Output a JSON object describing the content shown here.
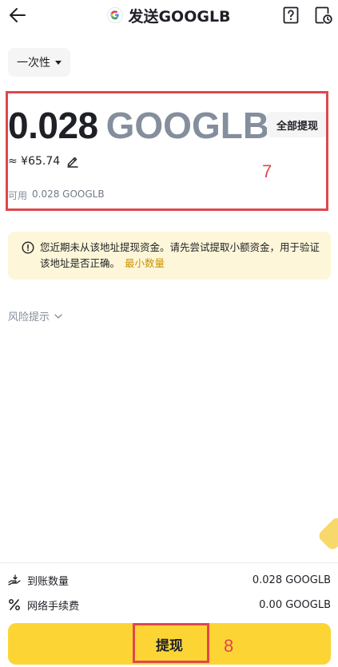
{
  "header": {
    "title": "发送GOOGLB",
    "coin_logo_icon": "google-g-logo",
    "back_icon": "arrow-left-icon",
    "help_icon": "question-mark-icon",
    "history_icon": "document-clock-icon"
  },
  "withdraw_type": {
    "selected": "一次性"
  },
  "amount": {
    "value": "0.028",
    "unit": "GOOGLB",
    "max_label": "全部提现",
    "fiat_estimate": "≈ ¥65.74",
    "available_label": "可用",
    "available_value": "0.028 GOOGLB"
  },
  "warning": {
    "text": "您近期未从该地址提现资金。请先尝试提取小额资金，用于验证该地址是否正确。",
    "link": "最小数量"
  },
  "risk": {
    "label": "风险提示"
  },
  "summary": {
    "receive_label": "到账数量",
    "receive_value": "0.028 GOOGLB",
    "fee_label": "网络手续费",
    "fee_value": "0.00 GOOGLB"
  },
  "submit": {
    "label": "提现"
  },
  "annotations": {
    "amount_box": "7",
    "submit_box": "8"
  },
  "colors": {
    "brand_yellow": "#fcd535",
    "warning_bg": "#fef6d8",
    "link_gold": "#c99400",
    "annotation_red": "#e0474c",
    "muted_gray": "#848e9c"
  }
}
